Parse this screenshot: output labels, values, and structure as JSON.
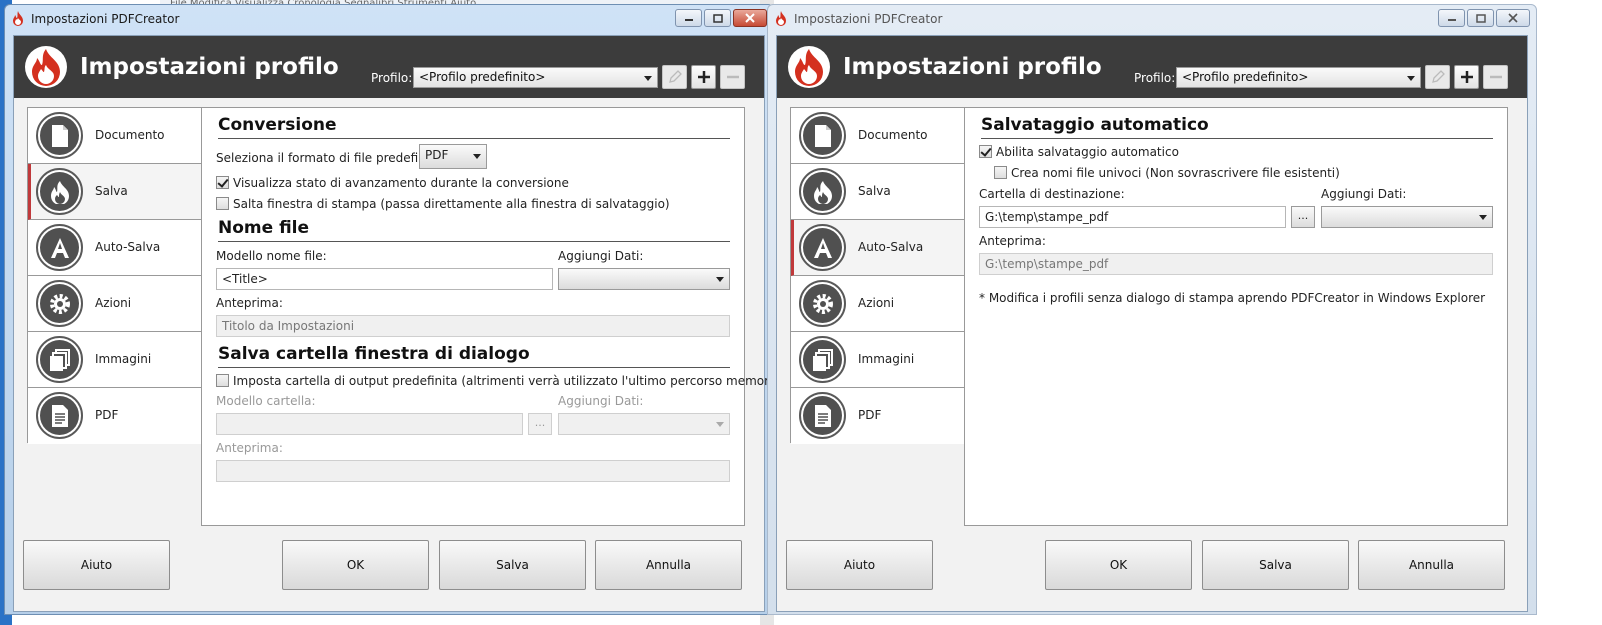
{
  "window_title": "Impostazioni PDFCreator",
  "header_title": "Impostazioni profilo",
  "profile_label": "Profilo:",
  "profile_value": "<Profilo predefinito>",
  "nav_items": [
    "Documento",
    "Salva",
    "Auto-Salva",
    "Azioni",
    "Immagini",
    "PDF"
  ],
  "buttons": {
    "help": "Aiuto",
    "ok": "OK",
    "save": "Salva",
    "cancel": "Annulla",
    "browse": "..."
  },
  "background_menu": "File   Modifica   Visualizza   Cronologia   Segnalibri   Strumenti   Aiuto",
  "left": {
    "conversion_title": "Conversione",
    "format_label": "Seleziona il formato di file predefinito:",
    "format_value": "PDF",
    "progress_label": "Visualizza stato di avanzamento durante la conversione",
    "progress_checked": true,
    "skip_label": "Salta finestra di stampa (passa direttamente alla finestra di salvataggio)",
    "skip_checked": false,
    "filename_title": "Nome file",
    "filename_template_label": "Modello nome file:",
    "filename_template_value": "<Title>",
    "add_data_label": "Aggiungi Dati:",
    "preview_label": "Anteprima:",
    "preview_value": "Titolo da Impostazioni",
    "dialog_folder_title": "Salva cartella finestra di dialogo",
    "default_output_label": "Imposta cartella di output predefinita (altrimenti verrà utilizzato l'ultimo percorso memorizzato)",
    "default_output_checked": false,
    "folder_template_label": "Modello cartella:",
    "folder_add_data_label": "Aggiungi Dati:",
    "folder_preview_label": "Anteprima:"
  },
  "right": {
    "autosave_title": "Salvataggio automatico",
    "enable_label": "Abilita salvataggio automatico",
    "enable_checked": true,
    "unique_label": "Crea nomi file univoci (Non sovrascrivere file esistenti)",
    "unique_checked": false,
    "dest_label": "Cartella di destinazione:",
    "dest_value": "G:\\temp\\stampe_pdf",
    "add_data_label": "Aggiungi Dati:",
    "preview_label": "Anteprima:",
    "preview_value": "G:\\temp\\stampe_pdf",
    "note": "* Modifica i profili senza dialogo di stampa aprendo PDFCreator in Windows Explorer"
  }
}
